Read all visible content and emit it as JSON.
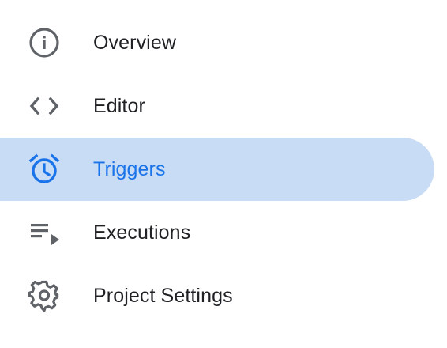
{
  "colors": {
    "icon": "#5f6368",
    "text": "#202124",
    "active_text": "#1a73e8",
    "active_background": "#c9dcf5"
  },
  "nav": {
    "active_index": 2,
    "items": [
      {
        "label": "Overview",
        "icon": "info-icon"
      },
      {
        "label": "Editor",
        "icon": "code-icon"
      },
      {
        "label": "Triggers",
        "icon": "alarm-clock-icon"
      },
      {
        "label": "Executions",
        "icon": "playlist-play-icon"
      },
      {
        "label": "Project Settings",
        "icon": "gear-icon"
      }
    ]
  }
}
